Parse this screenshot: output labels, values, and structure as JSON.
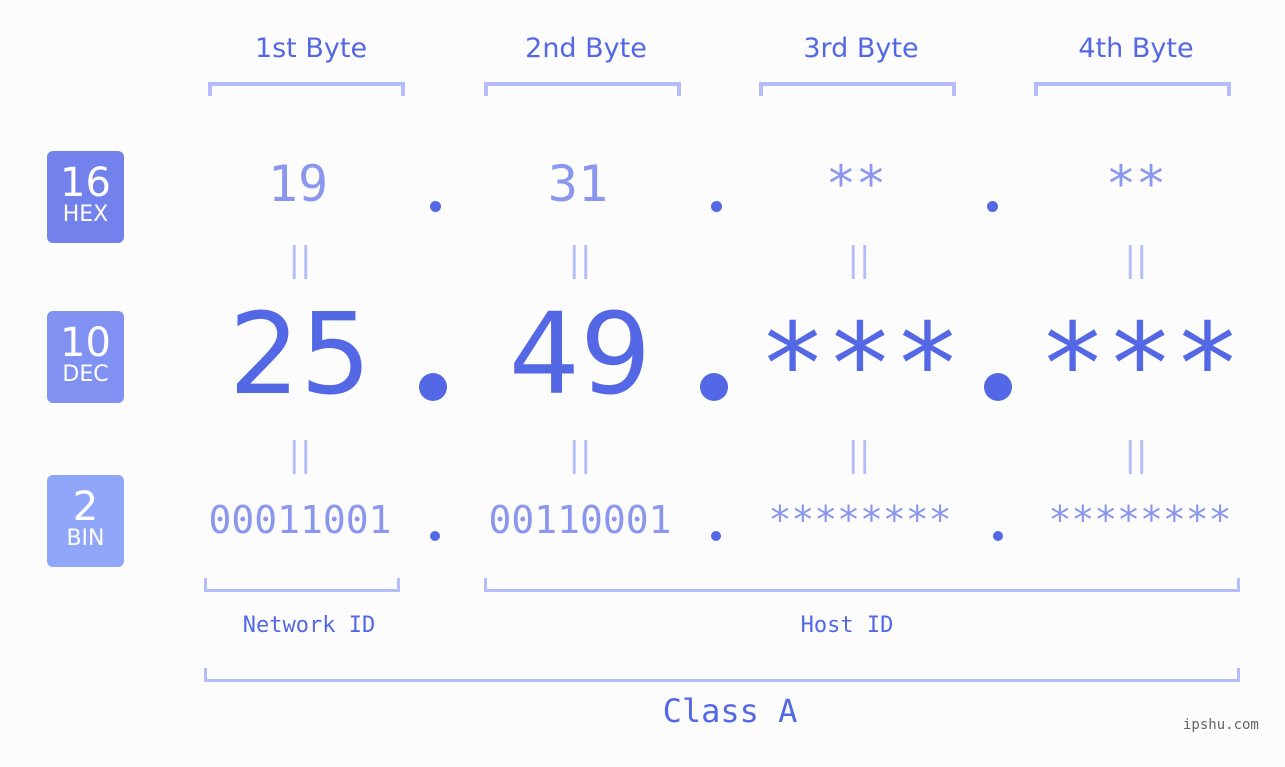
{
  "byte_headers": [
    "1st Byte",
    "2nd Byte",
    "3rd Byte",
    "4th Byte"
  ],
  "badges": {
    "hex": {
      "num": "16",
      "label": "HEX",
      "color": "#7381ec"
    },
    "dec": {
      "num": "10",
      "label": "DEC",
      "color": "#8191f1"
    },
    "bin": {
      "num": "2",
      "label": "BIN",
      "color": "#8fa6f9"
    }
  },
  "hex_values": [
    "19",
    "31",
    "**",
    "**"
  ],
  "dec_values": [
    "25",
    "49",
    "***",
    "***"
  ],
  "bin_values": [
    "00011001",
    "00110001",
    "********",
    "********"
  ],
  "equals_sign": "||",
  "network_label": "Network ID",
  "host_label": "Host ID",
  "class_label": "Class A",
  "watermark": "ipshu.com"
}
